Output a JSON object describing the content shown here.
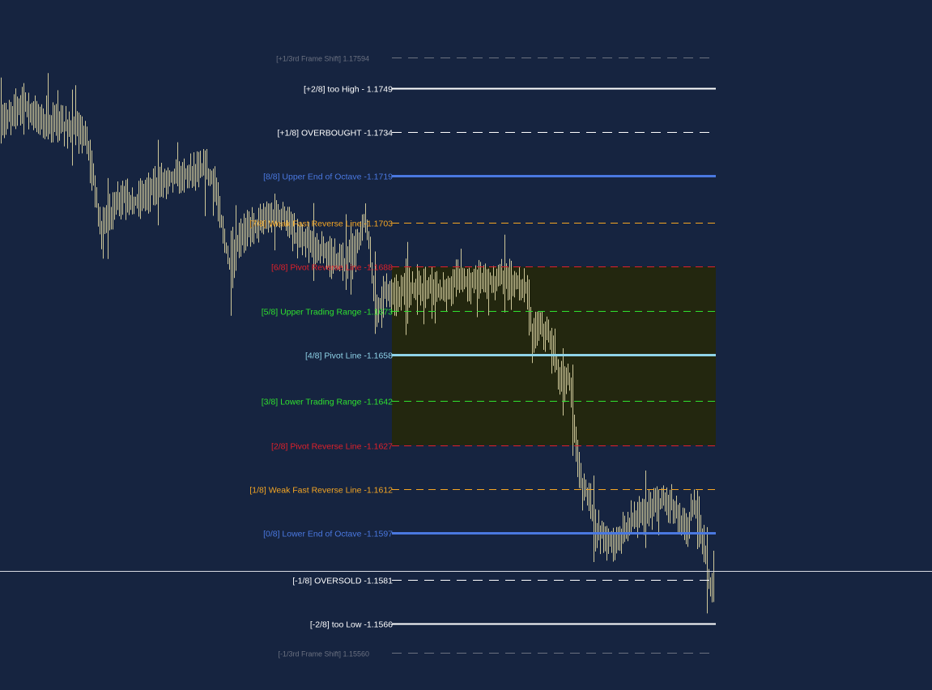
{
  "chart_data": {
    "type": "line",
    "title": "",
    "background_color": "#162440",
    "price_color": "#cfc89a",
    "ylim": [
      1.1555,
      1.176
    ],
    "current_price": 1.1584,
    "trading_zone": {
      "from": 1.1627,
      "to": 1.1688,
      "color": "#23270f"
    },
    "levels": [
      {
        "key": "frame_up",
        "label": "[+1/3rd Frame Shift]  1.17594",
        "value": 1.17594,
        "color": "#6b7180",
        "style": "dash-long",
        "label_style": "frame"
      },
      {
        "key": "p28",
        "label": "[+2/8] too High - 1.1749",
        "value": 1.1749,
        "color": "#ffffff",
        "style": "solid",
        "label_style": "level"
      },
      {
        "key": "p18",
        "label": "[+1/8] OVERBOUGHT -1.1734",
        "value": 1.1734,
        "color": "#ffffff",
        "style": "dash-long",
        "label_style": "level"
      },
      {
        "key": "l88",
        "label": "[8/8] Upper End of Octave -1.1719",
        "value": 1.1719,
        "color": "#4a78e0",
        "style": "solid-thick",
        "label_style": "level"
      },
      {
        "key": "l78",
        "label": "[7/8] Weak Fast Reverse Line -1.1703",
        "value": 1.1703,
        "color": "#f5a623",
        "style": "dash",
        "label_style": "level"
      },
      {
        "key": "l68",
        "label": "[6/8] Pivot Reverse Line -1.1688",
        "value": 1.1688,
        "color": "#e0202a",
        "style": "dash",
        "label_style": "level"
      },
      {
        "key": "l58",
        "label": "[5/8] Upper Trading Range -1.1673",
        "value": 1.1673,
        "color": "#2fe02f",
        "style": "dash",
        "label_style": "level"
      },
      {
        "key": "l48",
        "label": "[4/8] Pivot Line -1.1658",
        "value": 1.1658,
        "color": "#8fd3e8",
        "style": "solid-thick",
        "label_style": "level"
      },
      {
        "key": "l38",
        "label": "[3/8] Lower Trading Range -1.1642",
        "value": 1.1642,
        "color": "#2fe02f",
        "style": "dash",
        "label_style": "level"
      },
      {
        "key": "l28",
        "label": "[2/8] Pivot Reverse Line -1.1627",
        "value": 1.1627,
        "color": "#e0202a",
        "style": "dash",
        "label_style": "level"
      },
      {
        "key": "l18",
        "label": "[1/8] Weak Fast Reverse Line -1.1612",
        "value": 1.1612,
        "color": "#f5a623",
        "style": "dash",
        "label_style": "level"
      },
      {
        "key": "l08",
        "label": "[0/8] Lower End of Octave -1.1597",
        "value": 1.1597,
        "color": "#4a78e0",
        "style": "solid-thick",
        "label_style": "level"
      },
      {
        "key": "m18",
        "label": "[-1/8] OVERSOLD -1.1581",
        "value": 1.1581,
        "color": "#ffffff",
        "style": "dash-long",
        "label_style": "level"
      },
      {
        "key": "m28",
        "label": "[-2/8] too Low -1.1566",
        "value": 1.1566,
        "color": "#ffffff",
        "style": "solid",
        "label_style": "level"
      },
      {
        "key": "frame_dn",
        "label": "[-1/3rd Frame Shift]  1.15560",
        "value": 1.1556,
        "color": "#6b7180",
        "style": "dash-long",
        "label_style": "frame"
      }
    ],
    "series": [
      {
        "anchors": [
          [
            0,
            1.1737
          ],
          [
            10,
            1.1739
          ],
          [
            22,
            1.1743
          ],
          [
            30,
            1.1744
          ],
          [
            40,
            1.174
          ],
          [
            55,
            1.1738
          ],
          [
            70,
            1.1737
          ],
          [
            90,
            1.1735
          ],
          [
            105,
            1.1733
          ],
          [
            115,
            1.1718
          ],
          [
            125,
            1.17
          ],
          [
            135,
            1.1706
          ],
          [
            150,
            1.1712
          ],
          [
            165,
            1.171
          ],
          [
            180,
            1.1713
          ],
          [
            195,
            1.1716
          ],
          [
            210,
            1.1719
          ],
          [
            225,
            1.1719
          ],
          [
            240,
            1.1721
          ],
          [
            255,
            1.1721
          ],
          [
            265,
            1.1716
          ],
          [
            275,
            1.17
          ],
          [
            285,
            1.1686
          ],
          [
            295,
            1.1697
          ],
          [
            305,
            1.1701
          ],
          [
            320,
            1.1703
          ],
          [
            335,
            1.1705
          ],
          [
            350,
            1.1706
          ],
          [
            365,
            1.1698
          ],
          [
            380,
            1.1696
          ],
          [
            395,
            1.1694
          ],
          [
            410,
            1.1691
          ],
          [
            425,
            1.1689
          ],
          [
            440,
            1.1694
          ],
          [
            450,
            1.1705
          ],
          [
            458,
            1.169
          ],
          [
            465,
            1.1673
          ],
          [
            475,
            1.168
          ],
          [
            490,
            1.1678
          ],
          [
            505,
            1.1681
          ],
          [
            520,
            1.168
          ],
          [
            535,
            1.1682
          ],
          [
            550,
            1.1678
          ],
          [
            565,
            1.1684
          ],
          [
            580,
            1.1682
          ],
          [
            595,
            1.1684
          ],
          [
            610,
            1.1683
          ],
          [
            625,
            1.1684
          ],
          [
            640,
            1.1682
          ],
          [
            650,
            1.1681
          ],
          [
            657,
            1.1664
          ],
          [
            665,
            1.1668
          ],
          [
            675,
            1.1665
          ],
          [
            685,
            1.1658
          ],
          [
            695,
            1.1646
          ],
          [
            703,
            1.165
          ],
          [
            710,
            1.163
          ],
          [
            718,
            1.1612
          ],
          [
            728,
            1.161
          ],
          [
            735,
            1.1598
          ],
          [
            742,
            1.1597
          ],
          [
            752,
            1.1594
          ],
          [
            762,
            1.1594
          ],
          [
            775,
            1.16
          ],
          [
            790,
            1.1603
          ],
          [
            805,
            1.1605
          ],
          [
            818,
            1.1608
          ],
          [
            830,
            1.1607
          ],
          [
            840,
            1.1601
          ],
          [
            848,
            1.1598
          ],
          [
            855,
            1.1606
          ],
          [
            862,
            1.1602
          ],
          [
            868,
            1.1596
          ],
          [
            874,
            1.1584
          ],
          [
            878,
            1.1576
          ],
          [
            882,
            1.1581
          ]
        ]
      }
    ]
  }
}
